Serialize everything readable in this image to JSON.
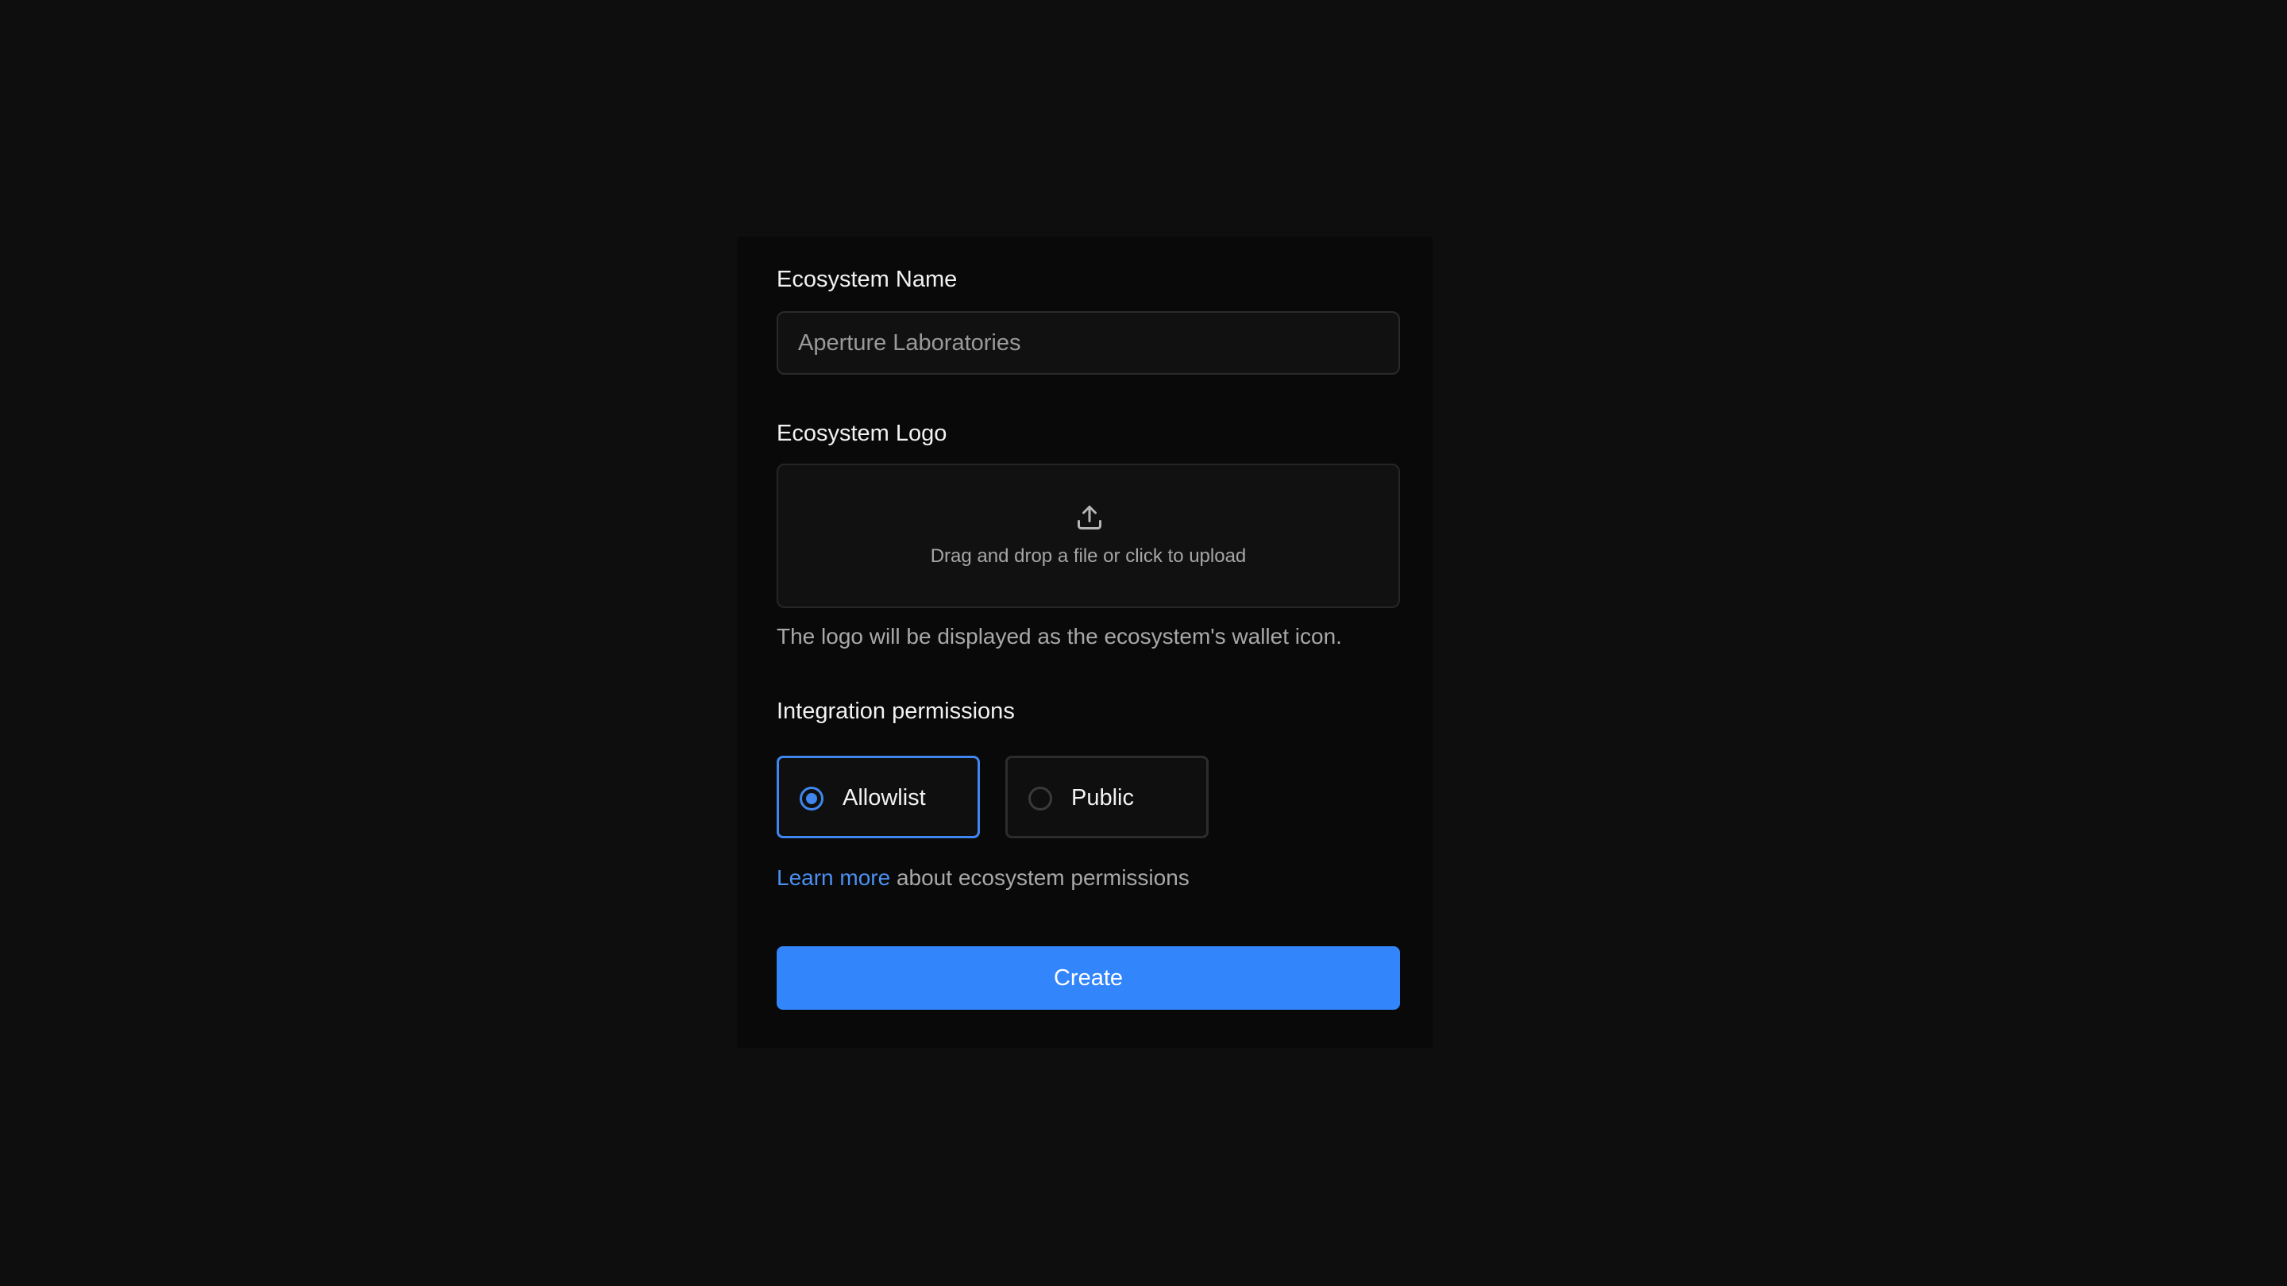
{
  "form": {
    "name_label": "Ecosystem Name",
    "name_placeholder": "Aperture Laboratories",
    "logo_label": "Ecosystem Logo",
    "upload_icon": "upload-icon",
    "dropzone_text": "Drag and drop a file or click to upload",
    "logo_helper": "The logo will be displayed as the ecosystem's wallet icon.",
    "permissions_label": "Integration permissions",
    "permissions": {
      "selected": "Allowlist",
      "options": [
        {
          "label": "Allowlist",
          "selected": true
        },
        {
          "label": "Public",
          "selected": false
        }
      ]
    },
    "learn_more_link": "Learn more",
    "learn_more_suffix": " about ecosystem permissions",
    "submit_label": "Create"
  },
  "colors": {
    "background": "#0e0e0e",
    "card": "#090909",
    "accent": "#3385fb",
    "link": "#4a90f0",
    "selected_border": "#3f86ee"
  }
}
